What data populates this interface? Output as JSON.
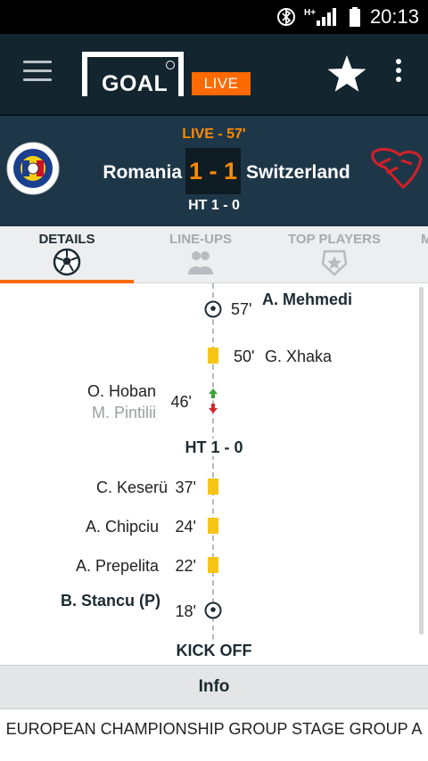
{
  "status_bar": {
    "time": "20:13",
    "network": "H+"
  },
  "app_bar": {
    "logo_text": "GOAL",
    "live_label": "LIVE"
  },
  "match": {
    "live_minute": "LIVE - 57'",
    "home_team": "Romania",
    "away_team": "Switzerland",
    "score": "1 - 1",
    "halftime": "HT 1 - 0"
  },
  "tabs": [
    {
      "label": "DETAILS",
      "icon": "soccer-ball-icon",
      "active": true
    },
    {
      "label": "LINE-UPS",
      "icon": "players-icon",
      "active": false
    },
    {
      "label": "TOP PLAYERS",
      "icon": "star-badge-icon",
      "active": false
    },
    {
      "label": "M",
      "icon": "",
      "active": false
    }
  ],
  "timeline": {
    "events": [
      {
        "side": "away",
        "type": "goal",
        "minute": "57'",
        "player": "A. Mehmedi"
      },
      {
        "side": "away",
        "type": "yellow-card",
        "minute": "50'",
        "player": "G. Xhaka"
      },
      {
        "side": "home",
        "type": "substitution",
        "minute": "46'",
        "player_in": "O. Hoban",
        "player_out": "M. Pintilii"
      },
      {
        "side": "home",
        "type": "yellow-card",
        "minute": "37'",
        "player": "C. Keserü"
      },
      {
        "side": "home",
        "type": "yellow-card",
        "minute": "24'",
        "player": "A. Chipciu"
      },
      {
        "side": "home",
        "type": "yellow-card",
        "minute": "22'",
        "player": "A. Prepelita"
      },
      {
        "side": "home",
        "type": "goal",
        "minute": "18'",
        "player": "B. Stancu (P)"
      }
    ],
    "halftime_marker": "HT 1 - 0",
    "kickoff_marker": "KICK OFF"
  },
  "info": {
    "label": "Info",
    "competition": "EUROPEAN CHAMPIONSHIP GROUP STAGE GROUP A"
  },
  "colors": {
    "accent": "#ff6a00",
    "header_bg": "#13252f",
    "match_bg": "#1e3748",
    "yellow_card": "#f6c417"
  }
}
